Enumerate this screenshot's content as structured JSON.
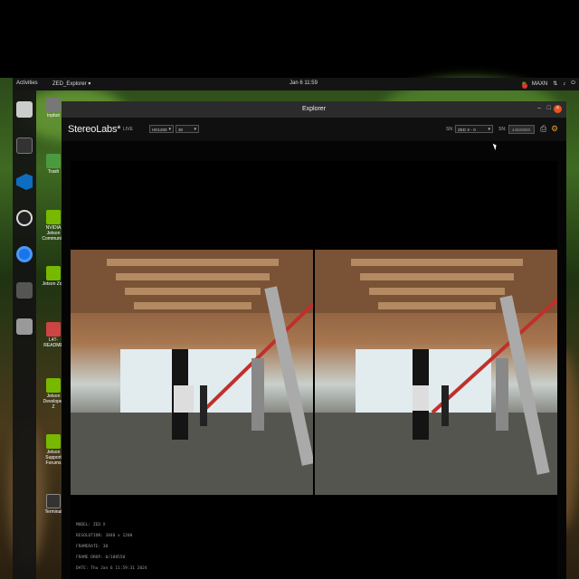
{
  "topbar": {
    "activities": "Activities",
    "app_menu": "ZED_Explorer ▾",
    "clock": "Jan 6 11:59",
    "power_mode": "MAXN",
    "indicators": [
      "record-icon",
      "nvidia-icon",
      "network-icon",
      "volume-icon",
      "power-icon"
    ]
  },
  "dock": {
    "items": [
      "files-icon",
      "terminal-icon",
      "vscode-icon",
      "obs-icon",
      "chromium-icon",
      "app-icon",
      "drive-icon"
    ]
  },
  "desktop_icons": [
    {
      "label": "Inpbot",
      "icon": "app-icon"
    },
    {
      "label": "Trash",
      "icon": "trash-icon"
    },
    {
      "label": "NVIDIA Jetson Community",
      "icon": "nvidia-icon"
    },
    {
      "label": "Jetson Zoo",
      "icon": "nvidia-icon"
    },
    {
      "label": "L4T-README",
      "icon": "drive-icon"
    },
    {
      "label": "Jetson Developer Z",
      "icon": "nvidia-icon"
    },
    {
      "label": "Jetson Support Forums",
      "icon": "nvidia-icon"
    },
    {
      "label": "Terminal",
      "icon": "terminal-icon"
    }
  ],
  "window": {
    "title": "Explorer",
    "controls": {
      "minimize": "–",
      "maximize": "□",
      "close": "×"
    }
  },
  "toolbar": {
    "brand": "StereoLabs*",
    "status": "LIVE",
    "resolution_value": "HD1200",
    "fps_value": "30",
    "sn_label": "SN :",
    "sn_value": "ZED X - 0",
    "gain_label": "SN:",
    "gain_value": "44820800"
  },
  "info": {
    "model": "MODEL: ZED X",
    "resolution": "RESOLUTION: 3840 x 1200",
    "framerate": "FRAMERATE: 30",
    "frame_drop": "FRAME DROP: 0/188550",
    "date": "DATE: Thu Jan 6 11:59:31 2024"
  },
  "colors": {
    "accent": "#e95420",
    "window_bg": "#050505",
    "topbar_bg": "#141414"
  }
}
